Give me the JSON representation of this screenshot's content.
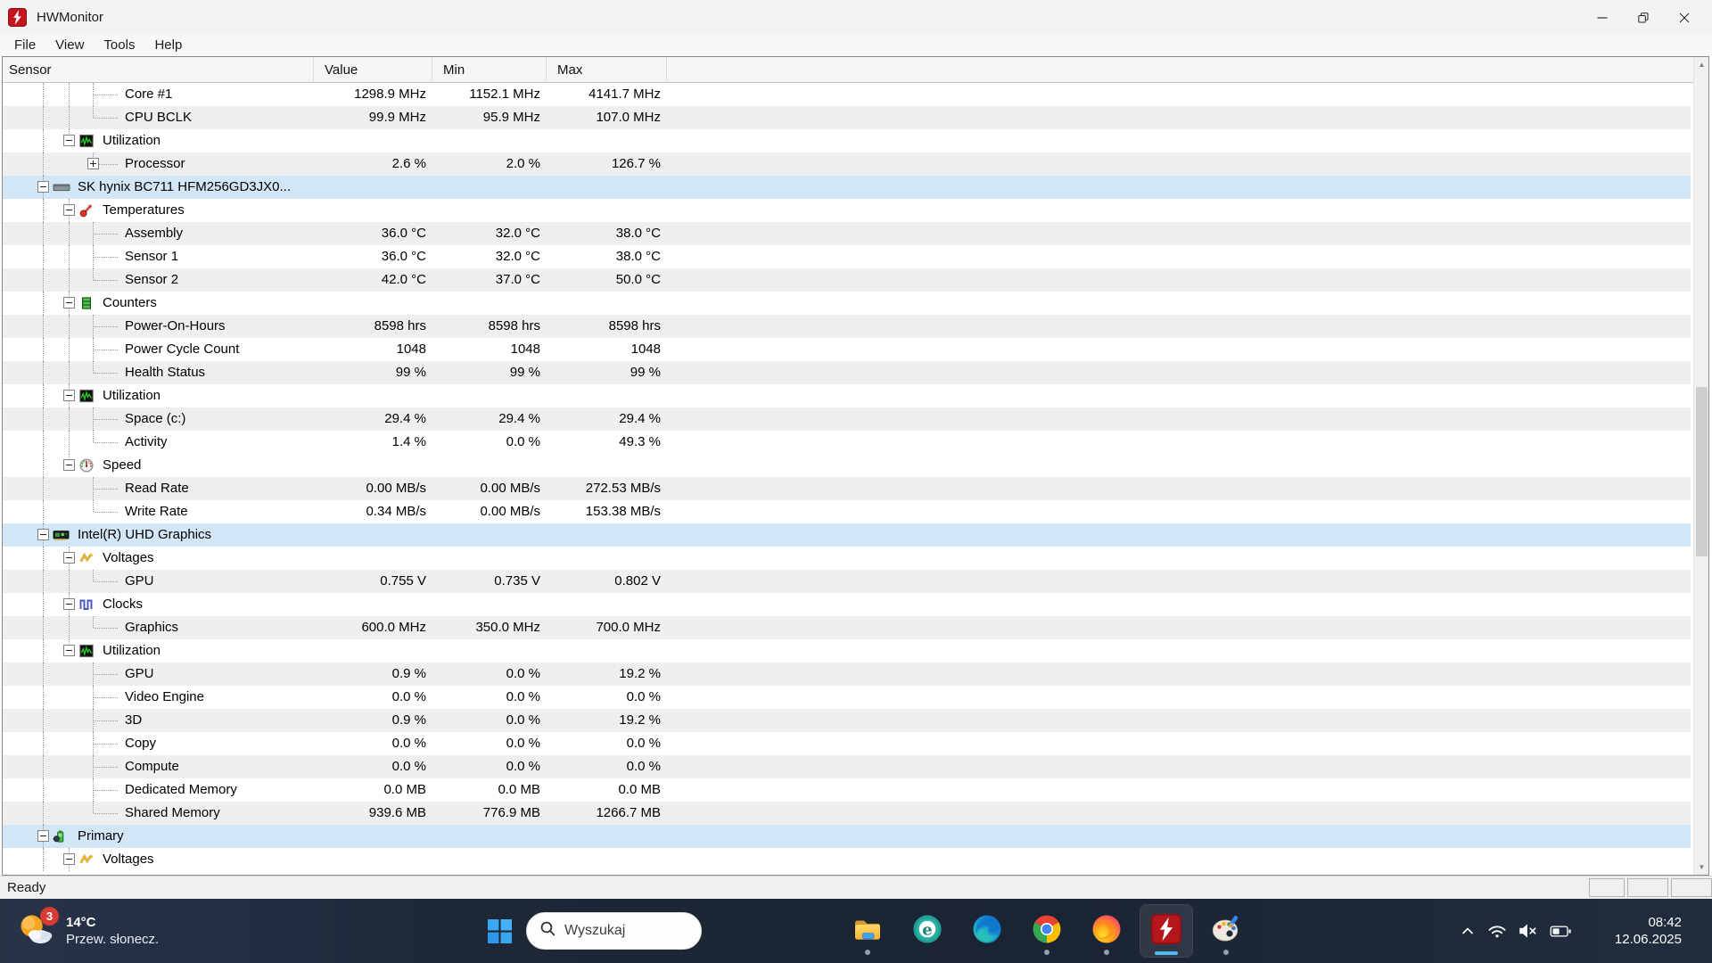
{
  "window": {
    "icon": "hwmonitor-logo-icon",
    "title": "HWMonitor",
    "menu": [
      "File",
      "View",
      "Tools",
      "Help"
    ],
    "status_left": "Ready",
    "status_pane_count": 3
  },
  "table": {
    "columns": [
      "Sensor",
      "Value",
      "Min",
      "Max"
    ],
    "rows": [
      {
        "t": "item",
        "label": "Core #1",
        "v": "1298.9 MHz",
        "min": "1152.1 MHz",
        "max": "4141.7 MHz",
        "bg": "w",
        "guides": [
          45,
          74
        ],
        "conn": 101
      },
      {
        "t": "item",
        "label": "CPU BCLK",
        "v": "99.9 MHz",
        "min": "95.9 MHz",
        "max": "107.0 MHz",
        "bg": "g",
        "guides": [
          45,
          74
        ],
        "conn": 101,
        "last": true
      },
      {
        "t": "group",
        "icon": "utilization-icon",
        "label": "Utilization",
        "bg": "w",
        "guides": [
          45
        ],
        "conn": 74,
        "exp": "minus",
        "last": true
      },
      {
        "t": "item",
        "label": "Processor",
        "v": "2.6 %",
        "min": "2.0 %",
        "max": "126.7 %",
        "bg": "g",
        "guides": [
          45
        ],
        "conn": 101,
        "exp": "plus",
        "last": true
      },
      {
        "t": "device",
        "icon": "disk-icon",
        "label": "SK hynix BC711 HFM256GD3JX0...",
        "bg": "b",
        "guides": [],
        "conn": 45,
        "exp": "minus"
      },
      {
        "t": "group",
        "icon": "temperature-icon",
        "label": "Temperatures",
        "bg": "w",
        "guides": [
          45
        ],
        "conn": 74,
        "exp": "minus"
      },
      {
        "t": "item",
        "label": "Assembly",
        "v": "36.0 °C",
        "min": "32.0 °C",
        "max": "38.0 °C",
        "bg": "g",
        "guides": [
          45,
          74
        ],
        "conn": 101
      },
      {
        "t": "item",
        "label": "Sensor 1",
        "v": "36.0 °C",
        "min": "32.0 °C",
        "max": "38.0 °C",
        "bg": "w",
        "guides": [
          45,
          74
        ],
        "conn": 101
      },
      {
        "t": "item",
        "label": "Sensor 2",
        "v": "42.0 °C",
        "min": "37.0 °C",
        "max": "50.0 °C",
        "bg": "g",
        "guides": [
          45,
          74
        ],
        "conn": 101,
        "last": true
      },
      {
        "t": "group",
        "icon": "counters-icon",
        "label": "Counters",
        "bg": "w",
        "guides": [
          45
        ],
        "conn": 74,
        "exp": "minus"
      },
      {
        "t": "item",
        "label": "Power-On-Hours",
        "v": "8598 hrs",
        "min": "8598 hrs",
        "max": "8598 hrs",
        "bg": "g",
        "guides": [
          45,
          74
        ],
        "conn": 101
      },
      {
        "t": "item",
        "label": "Power Cycle Count",
        "v": "1048",
        "min": "1048",
        "max": "1048",
        "bg": "w",
        "guides": [
          45,
          74
        ],
        "conn": 101
      },
      {
        "t": "item",
        "label": "Health Status",
        "v": "99 %",
        "min": "99 %",
        "max": "99 %",
        "bg": "g",
        "guides": [
          45,
          74
        ],
        "conn": 101,
        "last": true
      },
      {
        "t": "group",
        "icon": "utilization-icon",
        "label": "Utilization",
        "bg": "w",
        "guides": [
          45
        ],
        "conn": 74,
        "exp": "minus"
      },
      {
        "t": "item",
        "label": "Space (c:)",
        "v": "29.4 %",
        "min": "29.4 %",
        "max": "29.4 %",
        "bg": "g",
        "guides": [
          45,
          74
        ],
        "conn": 101
      },
      {
        "t": "item",
        "label": "Activity",
        "v": "1.4 %",
        "min": "0.0 %",
        "max": "49.3 %",
        "bg": "w",
        "guides": [
          45,
          74
        ],
        "conn": 101,
        "last": true
      },
      {
        "t": "group",
        "icon": "speed-icon",
        "label": "Speed",
        "bg": "w",
        "guides": [
          45
        ],
        "conn": 74,
        "exp": "minus",
        "last": true
      },
      {
        "t": "item",
        "label": "Read Rate",
        "v": "0.00 MB/s",
        "min": "0.00 MB/s",
        "max": "272.53 MB/s",
        "bg": "g",
        "guides": [
          45
        ],
        "conn": 101
      },
      {
        "t": "item",
        "label": "Write Rate",
        "v": "0.34 MB/s",
        "min": "0.00 MB/s",
        "max": "153.38 MB/s",
        "bg": "w",
        "guides": [
          45
        ],
        "conn": 101,
        "last": true
      },
      {
        "t": "device",
        "icon": "gpu-icon",
        "label": "Intel(R) UHD Graphics",
        "bg": "b",
        "guides": [],
        "conn": 45,
        "exp": "minus"
      },
      {
        "t": "group",
        "icon": "voltage-icon",
        "label": "Voltages",
        "bg": "w",
        "guides": [
          45
        ],
        "conn": 74,
        "exp": "minus"
      },
      {
        "t": "item",
        "label": "GPU",
        "v": "0.755 V",
        "min": "0.735 V",
        "max": "0.802 V",
        "bg": "g",
        "guides": [
          45,
          74
        ],
        "conn": 101,
        "last": true
      },
      {
        "t": "group",
        "icon": "clocks-icon",
        "label": "Clocks",
        "bg": "w",
        "guides": [
          45
        ],
        "conn": 74,
        "exp": "minus"
      },
      {
        "t": "item",
        "label": "Graphics",
        "v": "600.0 MHz",
        "min": "350.0 MHz",
        "max": "700.0 MHz",
        "bg": "g",
        "guides": [
          45,
          74
        ],
        "conn": 101,
        "last": true
      },
      {
        "t": "group",
        "icon": "utilization-icon",
        "label": "Utilization",
        "bg": "w",
        "guides": [
          45
        ],
        "conn": 74,
        "exp": "minus",
        "last": true
      },
      {
        "t": "item",
        "label": "GPU",
        "v": "0.9 %",
        "min": "0.0 %",
        "max": "19.2 %",
        "bg": "g",
        "guides": [
          45
        ],
        "conn": 101
      },
      {
        "t": "item",
        "label": "Video Engine",
        "v": "0.0 %",
        "min": "0.0 %",
        "max": "0.0 %",
        "bg": "w",
        "guides": [
          45
        ],
        "conn": 101
      },
      {
        "t": "item",
        "label": "3D",
        "v": "0.9 %",
        "min": "0.0 %",
        "max": "19.2 %",
        "bg": "g",
        "guides": [
          45
        ],
        "conn": 101
      },
      {
        "t": "item",
        "label": "Copy",
        "v": "0.0 %",
        "min": "0.0 %",
        "max": "0.0 %",
        "bg": "w",
        "guides": [
          45
        ],
        "conn": 101
      },
      {
        "t": "item",
        "label": "Compute",
        "v": "0.0 %",
        "min": "0.0 %",
        "max": "0.0 %",
        "bg": "g",
        "guides": [
          45
        ],
        "conn": 101
      },
      {
        "t": "item",
        "label": "Dedicated Memory",
        "v": "0.0 MB",
        "min": "0.0 MB",
        "max": "0.0 MB",
        "bg": "w",
        "guides": [
          45
        ],
        "conn": 101
      },
      {
        "t": "item",
        "label": "Shared Memory",
        "v": "939.6 MB",
        "min": "776.9 MB",
        "max": "1266.7 MB",
        "bg": "g",
        "guides": [
          45
        ],
        "conn": 101,
        "last": true
      },
      {
        "t": "device",
        "icon": "battery-plug-icon",
        "label": "Primary",
        "bg": "b",
        "guides": [],
        "conn": 45,
        "exp": "minus"
      },
      {
        "t": "group",
        "icon": "voltage-icon",
        "label": "Voltages",
        "bg": "w",
        "guides": [
          45
        ],
        "conn": 74,
        "exp": "minus"
      }
    ]
  },
  "taskbar": {
    "weather": {
      "icon": "sun-cloud-icon",
      "badge": "3",
      "temp": "14°C",
      "condition": "Przew. słonecz."
    },
    "start": {
      "icon": "windows-start-icon"
    },
    "search": {
      "icon": "search-icon",
      "placeholder": "Wyszukaj"
    },
    "apps": [
      {
        "name": "file-explorer",
        "icon": "folder-icon",
        "running": true,
        "active": false
      },
      {
        "name": "eset",
        "icon": "eset-icon",
        "running": false,
        "active": false
      },
      {
        "name": "edge",
        "icon": "edge-icon",
        "running": false,
        "active": false
      },
      {
        "name": "chrome",
        "icon": "chrome-icon",
        "running": true,
        "active": false
      },
      {
        "name": "firefox",
        "icon": "firefox-icon",
        "running": true,
        "active": false
      },
      {
        "name": "hwmonitor",
        "icon": "hwmonitor-task-icon",
        "running": true,
        "active": true
      },
      {
        "name": "paint",
        "icon": "paint-icon",
        "running": true,
        "active": false
      }
    ],
    "tray": {
      "chevron": "chevron-up-icon",
      "icons": [
        "wifi-icon",
        "volume-mute-icon",
        "battery-icon"
      ],
      "time": "08:42",
      "date": "12.06.2025"
    }
  },
  "colors": {
    "row_alt": "#efefef",
    "row_device": "#d3e6f6",
    "taskbar_bg": "#1d2736",
    "active_indicator": "#53b9f3",
    "badge_red": "#d83b30",
    "hwmonitor_red": "#c4151c"
  }
}
